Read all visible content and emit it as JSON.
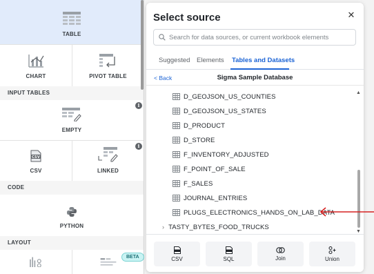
{
  "left_panel": {
    "tiles": {
      "table": "TABLE",
      "chart": "CHART",
      "pivot_table": "PIVOT TABLE",
      "empty": "EMPTY",
      "csv": "CSV",
      "linked": "LINKED",
      "python": "PYTHON"
    },
    "sections": {
      "input_tables": "INPUT TABLES",
      "code": "CODE",
      "layout": "LAYOUT"
    },
    "info_glyph": "i",
    "beta_badge": "BETA"
  },
  "dialog": {
    "title": "Select source",
    "close_glyph": "✕",
    "search": {
      "placeholder": "Search for data sources, or current workbook elements",
      "value": ""
    },
    "tabs": [
      "Suggested",
      "Elements",
      "Tables and Datasets"
    ],
    "active_tab": "Tables and Datasets",
    "back_label": "< Back",
    "database_title": "Sigma Sample Database",
    "tables": [
      "D_GEOJSON_US_COUNTIES",
      "D_GEOJSON_US_STATES",
      "D_PRODUCT",
      "D_STORE",
      "F_INVENTORY_ADJUSTED",
      "F_POINT_OF_SALE",
      "F_SALES",
      "JOURNAL_ENTRIES",
      "PLUGS_ELECTRONICS_HANDS_ON_LAB_DATA"
    ],
    "folder": {
      "chevron": "›",
      "label": "TASTY_BYTES_FOOD_TRUCKS"
    },
    "footer_buttons": [
      "CSV",
      "SQL",
      "Join",
      "Union"
    ]
  },
  "colors": {
    "accent": "#1b63d5",
    "selected_tile": "#e1ebfb",
    "annotation_arrow": "#d62020"
  }
}
